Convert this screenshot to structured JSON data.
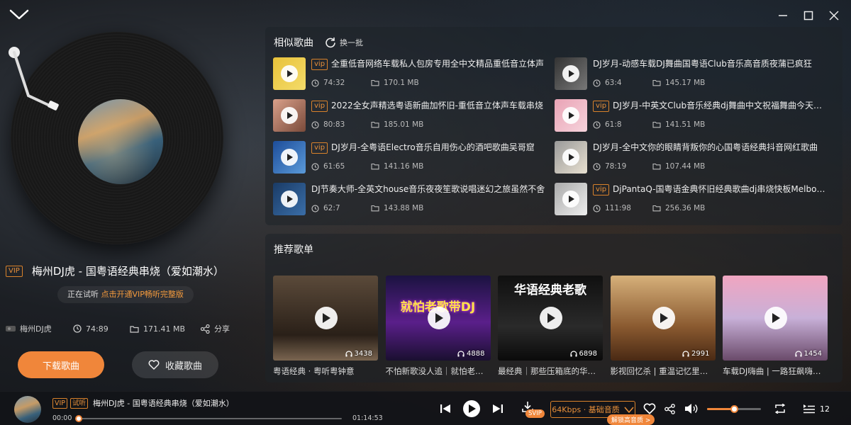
{
  "window": {
    "collapse_icon": "chevron-down-icon",
    "minimize_icon": "minimize-icon",
    "maximize_icon": "maximize-icon",
    "close_icon": "close-icon"
  },
  "now_playing": {
    "vip_tag": "VIP",
    "title": "梅州DJ虎 - 国粤语经典串烧（爱如潮水）",
    "trial_prefix": "正在试听 ",
    "trial_link": "点击开通VIP畅听完整版",
    "artist": "梅州DJ虎",
    "plays": "74:89",
    "size": "171.41 MB",
    "share_label": "分享",
    "download_label": "下载歌曲",
    "collect_label": "收藏歌曲"
  },
  "similar": {
    "title": "相似歌曲",
    "refresh_label": "换一批",
    "songs": [
      {
        "vip": "vip",
        "title": "全重低音网络车载私人包房专用全中文精品重低音立体声",
        "plays": "74:32",
        "size": "170.1 MB"
      },
      {
        "vip": "",
        "title": "DJ岁月-动感车载DJ舞曲国粤语Club音乐高音质夜蒲已疯狂",
        "plays": "63:4",
        "size": "145.17 MB"
      },
      {
        "vip": "vip",
        "title": "2022全女声精选粤语新曲加怀旧-重低音立体声车载串烧",
        "plays": "80:83",
        "size": "185.01 MB"
      },
      {
        "vip": "vip",
        "title": "DJ岁月-中英文Club音乐经典dj舞曲中文祝福舞曲今天是你的生日",
        "plays": "61:8",
        "size": "141.51 MB"
      },
      {
        "vip": "vip",
        "title": "DJ岁月-全粤语Electro音乐自用伤心的酒吧歌曲吴哥窟",
        "plays": "61:65",
        "size": "141.16 MB"
      },
      {
        "vip": "",
        "title": "DJ岁月-全中文你的眼睛背叛你的心国粤语经典抖音网红歌曲",
        "plays": "78:19",
        "size": "107.44 MB"
      },
      {
        "vip": "",
        "title": "DJ节奏大师-全英文house音乐夜夜笙歌说唱迷幻之旅虽然不舍",
        "plays": "62:7",
        "size": "143.88 MB"
      },
      {
        "vip": "vip",
        "title": "DjPantaQ-国粤语金典怀旧经典歌曲dj串烧快板Melbourne",
        "plays": "111:98",
        "size": "256.36 MB"
      }
    ]
  },
  "recommend": {
    "title": "推荐歌单",
    "playlists": [
      {
        "name": "粤语经典 · 粤听粤钟意",
        "count": "3438",
        "cover_text": ""
      },
      {
        "name": "不怕新歌没人追｜就怕老歌带DJ",
        "count": "4888",
        "cover_text": "就怕老歌带DJ"
      },
      {
        "name": "最经典｜那些压箱底的华语经典老歌",
        "count": "6898",
        "cover_text": "华语经典老歌"
      },
      {
        "name": "影视回忆杀 | 重温记忆里的经典",
        "count": "2991",
        "cover_text": ""
      },
      {
        "name": "车载DJ嗨曲 | 一路狂飙嗨到底",
        "count": "1454",
        "cover_text": ""
      }
    ]
  },
  "player": {
    "vip_tag": "VIP",
    "trial_tag": "试听",
    "title": "梅州DJ虎 - 国粤语经典串烧（爱如潮水）",
    "current_time": "00:00",
    "total_time": "01:14:53",
    "progress": 0,
    "quality_label": "64Kbps · 基础音质",
    "unlock_label": "解锁高音质 >",
    "svip_label": "SVIP",
    "volume": 0.5,
    "queue_count": "12"
  },
  "colors": {
    "accent": "#f0863a",
    "vip": "#d9822b"
  }
}
